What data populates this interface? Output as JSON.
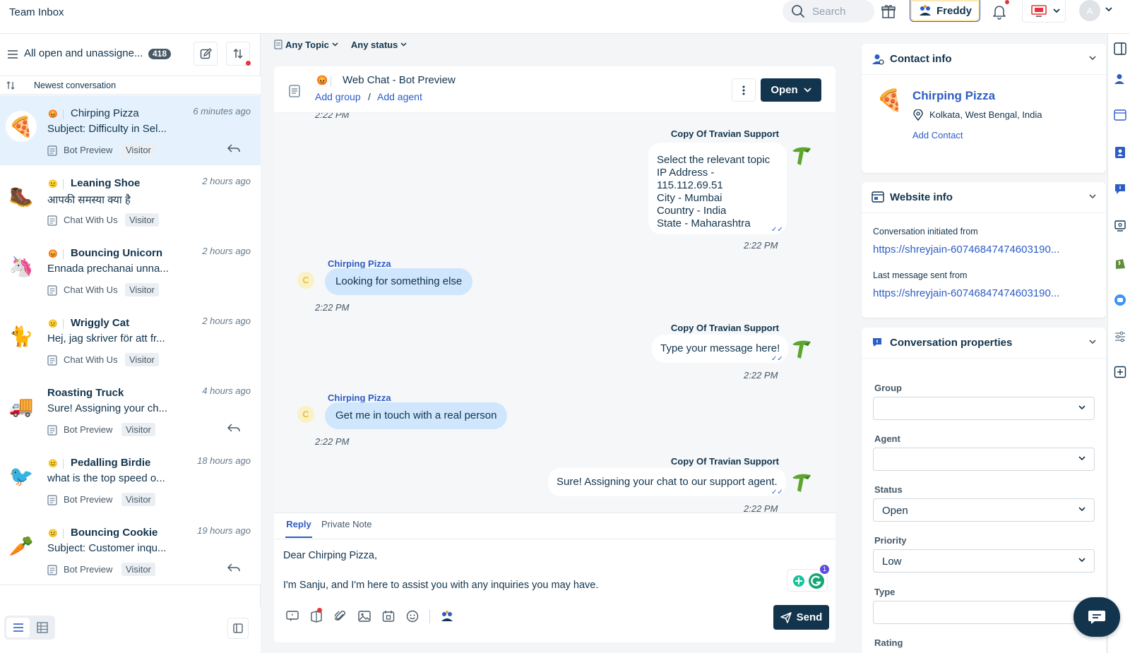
{
  "app": {
    "title": "Team Inbox"
  },
  "topbar": {
    "search_placeholder": "Search",
    "freddy_label": "Freddy",
    "avatar_initial": "A"
  },
  "colors": {
    "primary": "#12344d",
    "accent": "#2c5cc5",
    "alert": "#e43538",
    "user_bubble": "#cfe6fd",
    "active_row": "#e5f2fd"
  },
  "left": {
    "filter_title": "All open and unassigne...",
    "filter_count": "418",
    "sort_label": "Newest conversation",
    "conversations": [
      {
        "emoji": "😡",
        "name": "Chirping Pizza",
        "bold": false,
        "time": "6 minutes ago",
        "subject": "Subject: Difficulty in Sel...",
        "channel": "Bot Preview",
        "tag": "Visitor",
        "avatar": "🍕",
        "replied": true,
        "active": true
      },
      {
        "emoji": "😐",
        "name": "Leaning Shoe",
        "bold": true,
        "time": "2 hours ago",
        "subject": "आपकी समस्या क्या है",
        "channel": "Chat With Us",
        "tag": "Visitor",
        "avatar": "🥾",
        "replied": false,
        "active": false
      },
      {
        "emoji": "😡",
        "name": "Bouncing Unicorn",
        "bold": true,
        "time": "2 hours ago",
        "subject": "Ennada prechanai unna...",
        "channel": "Chat With Us",
        "tag": "Visitor",
        "avatar": "🦄",
        "replied": false,
        "active": false
      },
      {
        "emoji": "😐",
        "name": "Wriggly Cat",
        "bold": true,
        "time": "2 hours ago",
        "subject": "Hej, jag skriver för att fr...",
        "channel": "Chat With Us",
        "tag": "Visitor",
        "avatar": "🐈",
        "replied": false,
        "active": false
      },
      {
        "emoji": "",
        "name": "Roasting Truck",
        "bold": true,
        "time": "4 hours ago",
        "subject": "Sure! Assigning your ch...",
        "channel": "Bot Preview",
        "tag": "Visitor",
        "avatar": "🚚",
        "replied": true,
        "active": false
      },
      {
        "emoji": "😐",
        "name": "Pedalling Birdie",
        "bold": true,
        "time": "18 hours ago",
        "subject": "what is the top speed o...",
        "channel": "Bot Preview",
        "tag": "Visitor",
        "avatar": "🐦",
        "replied": false,
        "active": false
      },
      {
        "emoji": "😐",
        "name": "Bouncing Cookie",
        "bold": true,
        "time": "19 hours ago",
        "subject": "Subject: Customer inqu...",
        "channel": "Bot Preview",
        "tag": "Visitor",
        "avatar": "🥕",
        "replied": true,
        "active": false
      }
    ]
  },
  "filters": {
    "topic": "Any Topic",
    "status": "Any status"
  },
  "chat": {
    "emoji": "😡",
    "title": "Web Chat - Bot Preview",
    "add_group": "Add group",
    "slash": "/",
    "add_agent": "Add agent",
    "status_button": "Open",
    "top_time": "2:22 PM",
    "bot_name": "Copy Of Travian Support",
    "user_name": "Chirping Pizza",
    "user_initial": "C",
    "messages": {
      "bot1": [
        "Select the relevant topic",
        "IP Address - 115.112.69.51",
        "City - Mumbai",
        "Country - India",
        "State - Maharashtra"
      ],
      "bot1_time": "2:22 PM",
      "user1": "Looking for something else",
      "user1_time": "2:22 PM",
      "bot2": "Type your message here!",
      "bot2_time": "2:22 PM",
      "user2": "Get me in touch with a real person",
      "user2_time": "2:22 PM",
      "bot3": "Sure! Assigning your chat to our support agent.",
      "bot3_time": "2:22 PM"
    },
    "composer": {
      "tab_reply": "Reply",
      "tab_note": "Private Note",
      "line1": "Dear Chirping Pizza,",
      "line2": "I'm Sanju, and I'm here to assist you with any inquiries you may have.",
      "grammarly_count": "1",
      "send_label": "Send"
    }
  },
  "contact": {
    "section_title": "Contact info",
    "name": "Chirping Pizza",
    "location": "Kolkata, West Bengal, India",
    "add_contact": "Add Contact"
  },
  "website": {
    "section_title": "Website info",
    "initiated_label": "Conversation initiated from",
    "initiated_url": "https://shreyjain-60746847474603190...",
    "last_label": "Last message sent from",
    "last_url": "https://shreyjain-60746847474603190..."
  },
  "properties": {
    "section_title": "Conversation properties",
    "group_label": "Group",
    "group_value": "",
    "agent_label": "Agent",
    "agent_value": "",
    "status_label": "Status",
    "status_value": "Open",
    "priority_label": "Priority",
    "priority_value": "Low",
    "type_label": "Type",
    "type_value": "",
    "rating_label": "Rating"
  }
}
